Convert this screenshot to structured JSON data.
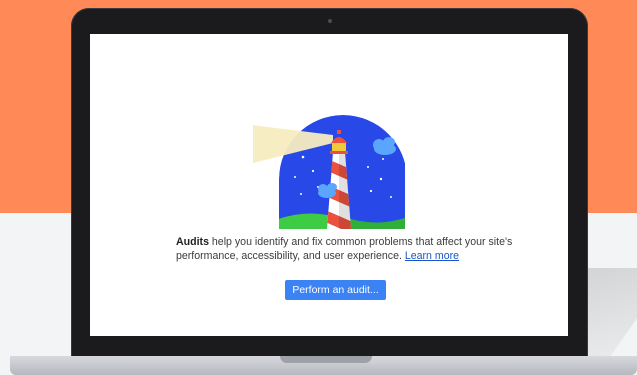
{
  "audit_panel": {
    "title_bold": "Audits",
    "description_rest": " help you identify and fix common problems that affect your site's performance, accessibility, and user experience. ",
    "learn_more": "Learn more",
    "button_label": "Perform an audit..."
  },
  "colors": {
    "background_accent": "#ff8a57",
    "button": "#3b82f5",
    "link": "#1a56c9",
    "logo_sky": "#2849e8",
    "logo_ground": "#3dcc44"
  },
  "icons": [
    "lighthouse-logo-icon",
    "webcam-icon"
  ]
}
